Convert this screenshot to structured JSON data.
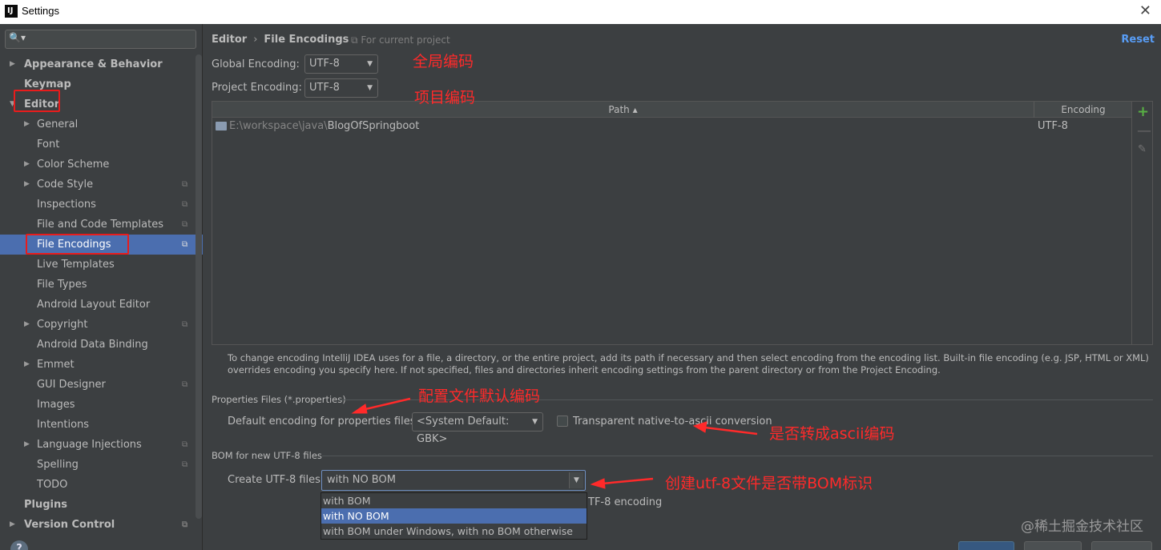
{
  "window": {
    "title": "Settings",
    "app_icon": "intellij-icon",
    "close_icon": "close-icon"
  },
  "sidebar": {
    "search_placeholder": "",
    "items": [
      {
        "label": "Appearance & Behavior",
        "level": 0,
        "expandable": true,
        "expanded": false,
        "project_icon": false
      },
      {
        "label": "Keymap",
        "level": 0,
        "expandable": false,
        "project_icon": false
      },
      {
        "label": "Editor",
        "level": 0,
        "expandable": true,
        "expanded": true,
        "project_icon": false
      },
      {
        "label": "General",
        "level": 1,
        "expandable": true,
        "expanded": false,
        "project_icon": false
      },
      {
        "label": "Font",
        "level": 1,
        "expandable": false,
        "project_icon": false
      },
      {
        "label": "Color Scheme",
        "level": 1,
        "expandable": true,
        "expanded": false,
        "project_icon": false
      },
      {
        "label": "Code Style",
        "level": 1,
        "expandable": true,
        "expanded": false,
        "project_icon": true
      },
      {
        "label": "Inspections",
        "level": 1,
        "expandable": false,
        "project_icon": true
      },
      {
        "label": "File and Code Templates",
        "level": 1,
        "expandable": false,
        "project_icon": true
      },
      {
        "label": "File Encodings",
        "level": 1,
        "expandable": false,
        "project_icon": true,
        "selected": true
      },
      {
        "label": "Live Templates",
        "level": 1,
        "expandable": false,
        "project_icon": false
      },
      {
        "label": "File Types",
        "level": 1,
        "expandable": false,
        "project_icon": false
      },
      {
        "label": "Android Layout Editor",
        "level": 1,
        "expandable": false,
        "project_icon": false
      },
      {
        "label": "Copyright",
        "level": 1,
        "expandable": true,
        "expanded": false,
        "project_icon": true
      },
      {
        "label": "Android Data Binding",
        "level": 1,
        "expandable": false,
        "project_icon": false
      },
      {
        "label": "Emmet",
        "level": 1,
        "expandable": true,
        "expanded": false,
        "project_icon": false
      },
      {
        "label": "GUI Designer",
        "level": 1,
        "expandable": false,
        "project_icon": true
      },
      {
        "label": "Images",
        "level": 1,
        "expandable": false,
        "project_icon": false
      },
      {
        "label": "Intentions",
        "level": 1,
        "expandable": false,
        "project_icon": false
      },
      {
        "label": "Language Injections",
        "level": 1,
        "expandable": true,
        "expanded": false,
        "project_icon": true
      },
      {
        "label": "Spelling",
        "level": 1,
        "expandable": false,
        "project_icon": true
      },
      {
        "label": "TODO",
        "level": 1,
        "expandable": false,
        "project_icon": false
      },
      {
        "label": "Plugins",
        "level": 0,
        "expandable": false,
        "project_icon": false
      },
      {
        "label": "Version Control",
        "level": 0,
        "expandable": true,
        "expanded": false,
        "project_icon": true
      }
    ],
    "help_label": "?"
  },
  "main": {
    "breadcrumb": [
      "Editor",
      "File Encodings"
    ],
    "breadcrumb_sep": "›",
    "for_current_project": "For current project",
    "reset": "Reset",
    "global_encoding_label": "Global Encoding:",
    "global_encoding_value": "UTF-8",
    "project_encoding_label": "Project Encoding:",
    "project_encoding_value": "UTF-8",
    "table": {
      "col_path": "Path ▴",
      "col_encoding": "Encoding",
      "rows": [
        {
          "path_dim": "E:\\workspace\\java\\",
          "path_name": "BlogOfSpringboot",
          "encoding": "UTF-8"
        }
      ]
    },
    "info_text": "To change encoding IntelliJ IDEA uses for a file, a directory, or the entire project, add its path if necessary and then select encoding from the encoding list. Built-in file encoding (e.g. JSP, HTML or XML) overrides encoding you specify here. If not specified, files and directories inherit encoding settings from the parent directory or from the Project Encoding.",
    "properties_section": "Properties Files (*.properties)",
    "default_props_label": "Default encoding for properties files:",
    "default_props_value": "<System Default: GBK>",
    "native_ascii_label": "Transparent native-to-ascii conversion",
    "native_ascii_checked": false,
    "bom_section": "BOM for new UTF-8 files",
    "create_utf8_label": "Create UTF-8 files:",
    "create_utf8_value": "with NO BOM",
    "create_utf8_options": [
      "with BOM",
      "with NO BOM",
      "with BOM under Windows, with no BOM otherwise"
    ],
    "create_utf8_selected_index": 1,
    "hidden_text_partial": "TF-8 encoding"
  },
  "annotations": {
    "global": "全局编码",
    "project": "项目编码",
    "properties": "配置文件默认编码",
    "ascii": "是否转成ascii编码",
    "bom": "创建utf-8文件是否带BOM标识",
    "color": "#ff2a2a"
  },
  "watermark": "@稀土掘金技术社区",
  "colors": {
    "background": "#3c3f41",
    "selection": "#4b6eaf",
    "link": "#589df6",
    "add": "#58b044"
  }
}
